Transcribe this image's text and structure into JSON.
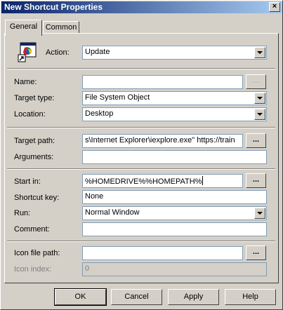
{
  "window": {
    "title": "New Shortcut Properties",
    "close_glyph": "×"
  },
  "tabs": [
    {
      "label": "General",
      "active": true
    },
    {
      "label": "Common",
      "active": false
    }
  ],
  "general": {
    "action": {
      "label": "Action:",
      "value": "Update"
    },
    "name": {
      "label": "Name:",
      "value": ""
    },
    "target_type": {
      "label": "Target type:",
      "value": "File System Object"
    },
    "location": {
      "label": "Location:",
      "value": "Desktop"
    },
    "target_path": {
      "label": "Target path:",
      "value": "s\\Internet Explorer\\iexplore.exe\" https://train"
    },
    "arguments": {
      "label": "Arguments:",
      "value": ""
    },
    "start_in": {
      "label": "Start in:",
      "value": "%HOMEDRIVE%%HOMEPATH%"
    },
    "shortcut_key": {
      "label": "Shortcut key:",
      "value": "None"
    },
    "run": {
      "label": "Run:",
      "value": "Normal Window"
    },
    "comment": {
      "label": "Comment:",
      "value": ""
    },
    "icon_file_path": {
      "label": "Icon file path:",
      "value": ""
    },
    "icon_index": {
      "label": "Icon index:",
      "value": "0",
      "disabled": true
    },
    "browse_label": "..."
  },
  "buttons": {
    "ok": "OK",
    "cancel": "Cancel",
    "apply": "Apply",
    "help": "Help"
  },
  "icons": {
    "action": "shortcut-window-icon",
    "browse": "ellipsis-icon",
    "dropdown": "chevron-down-icon",
    "close": "close-icon"
  },
  "colors": {
    "titlebar_start": "#0a246a",
    "titlebar_end": "#a6caf0",
    "dialog_face": "#d4d0c8",
    "field_border": "#7f9db9",
    "disabled_text": "#808080"
  }
}
